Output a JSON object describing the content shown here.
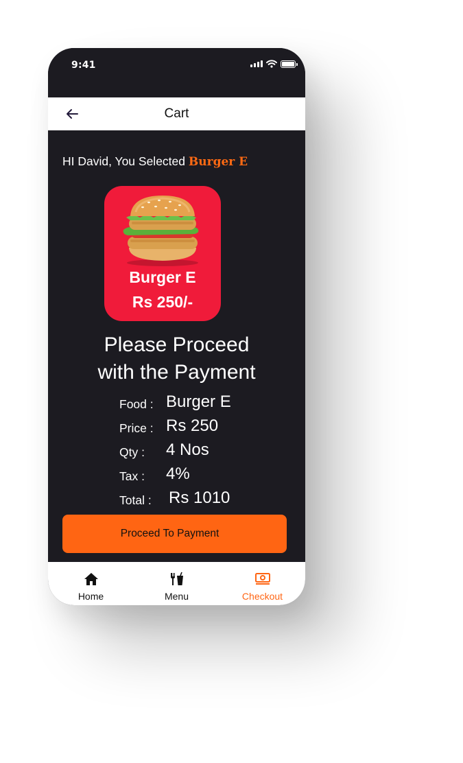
{
  "status_bar": {
    "time": "9:41"
  },
  "header": {
    "title": "Cart",
    "back_icon": "arrow-left-icon"
  },
  "greeting": {
    "prefix": "HI David, You Selected",
    "item": "Burger E"
  },
  "product_card": {
    "name": "Burger E",
    "price": "Rs 250/-",
    "image": "burger-image"
  },
  "proceed_message": {
    "line1": "Please Proceed",
    "line2": "with the Payment"
  },
  "order_details": [
    {
      "label": "Food :",
      "value": "Burger E"
    },
    {
      "label": "Price :",
      "value": "Rs 250"
    },
    {
      "label": "Qty :",
      "value": "4 Nos"
    },
    {
      "label": "Tax :",
      "value": "4%"
    },
    {
      "label": "Total  :",
      "value": "Rs 1010"
    }
  ],
  "pay_button": {
    "label": "Proceed To Payment"
  },
  "bottom_nav": [
    {
      "label": "Home",
      "icon": "home-icon",
      "active": false
    },
    {
      "label": "Menu",
      "icon": "fork-knife-cup-icon",
      "active": false
    },
    {
      "label": "Checkout",
      "icon": "money-icon",
      "active": true
    }
  ],
  "colors": {
    "accent": "#ff6513",
    "card": "#f01b3a",
    "background": "#1c1b21",
    "header": "#ffffff"
  }
}
